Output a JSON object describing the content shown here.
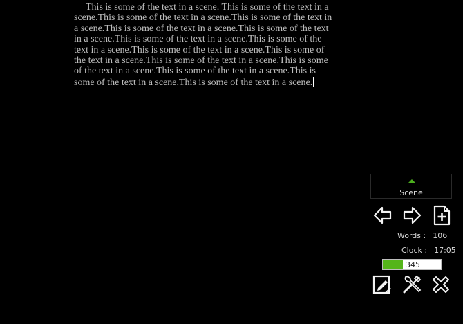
{
  "editor": {
    "text": "This is some of the text in a scene. This is some of the text in a scene.This is some of the text in a scene.This is some of the text in a scene.This is some of the text in a scene.This is some of the text in a scene.This is some of the text in a scene.This is some of the text in a scene.This is some of the text in a scene.This is some of the text in a scene.This is some of the text in a scene.This is some of the text in a scene.This is some of the text in a scene.This is some of the text in a scene.This is some of the text in a scene."
  },
  "panel": {
    "scene_tab_label": "Scene",
    "words_label": "Words :",
    "words_value": "106",
    "clock_label": "Clock :",
    "clock_value": "17:05",
    "progress_value": "345",
    "progress_fraction": 0.34
  },
  "icons": {
    "prev": "arrow-left-icon",
    "next": "arrow-right-icon",
    "new": "new-document-icon",
    "edit": "edit-note-icon",
    "tools": "tools-icon",
    "close": "close-icon"
  },
  "colors": {
    "accent": "#55b51a",
    "background": "#000000",
    "text": "#bdbdbd"
  }
}
